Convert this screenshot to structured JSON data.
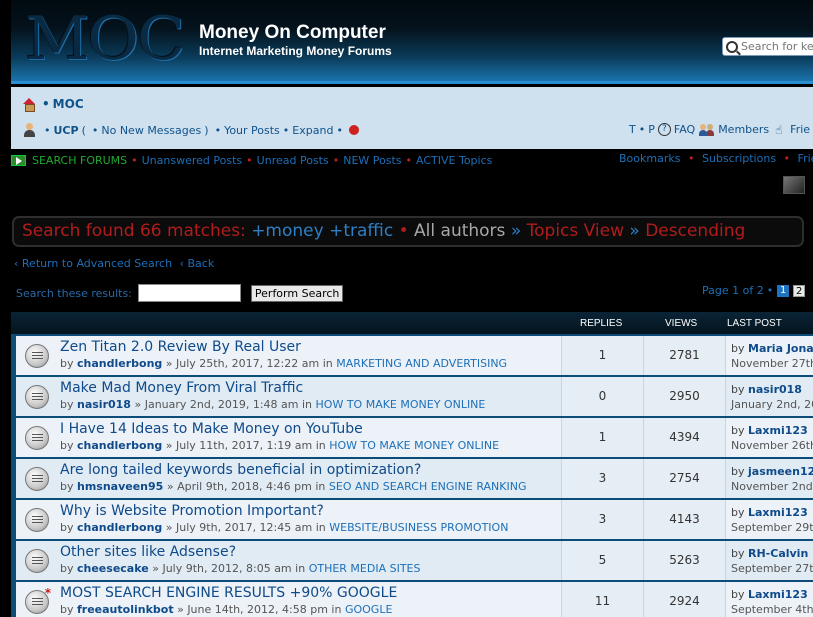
{
  "header": {
    "logo_text": "MOC",
    "site_title": "Money On Computer",
    "site_desc": "Internet Marketing Money Forums",
    "search_placeholder": "Search for ke"
  },
  "nav": {
    "home_label": "MOC",
    "ucp_label": "UCP",
    "new_messages": "No New Messages",
    "your_posts": "Your Posts",
    "expand": "Expand",
    "right_t": "T",
    "right_p": "P",
    "faq": "FAQ",
    "members": "Members",
    "friends": "Frie"
  },
  "quick": {
    "search_forums": "SEARCH FORUMS",
    "unanswered": "Unanswered Posts",
    "unread": "Unread Posts",
    "new_posts": "NEW Posts",
    "active": "ACTIVE Topics",
    "bookmarks": "Bookmarks",
    "subscriptions": "Subscriptions",
    "friends": "Frie"
  },
  "banner": {
    "prefix": "Search found 66 matches:",
    "terms": "+money +traffic",
    "authors": "All authors",
    "view": "Topics View",
    "order": "Descending"
  },
  "links": {
    "advanced": "Return to Advanced Search",
    "back": "Back"
  },
  "search_results": {
    "label": "Search these results:",
    "value": "",
    "button": "Perform Search"
  },
  "pagination": {
    "text": "Page 1 of 2",
    "current": "1",
    "next": "2"
  },
  "table_headers": {
    "replies": "REPLIES",
    "views": "VIEWS",
    "last_post": "LAST POST"
  },
  "topics": [
    {
      "title": "Zen Titan 2.0 Review By Real User",
      "author": "chandlerbong",
      "date": "July 25th, 2017, 12:22 am",
      "forum": "MARKETING AND ADVERTISING",
      "replies": "1",
      "views": "2781",
      "last_by": "Maria Jonas",
      "last_date": "November 27th"
    },
    {
      "title": "Make Mad Money From Viral Traffic",
      "author": "nasir018",
      "date": "January 2nd, 2019, 1:48 am",
      "forum": "HOW TO MAKE MONEY ONLINE",
      "replies": "0",
      "views": "2950",
      "last_by": "nasir018",
      "last_date": "January 2nd, 20"
    },
    {
      "title": "I Have 14 Ideas to Make Money on YouTube",
      "author": "chandlerbong",
      "date": "July 11th, 2017, 1:19 am",
      "forum": "HOW TO MAKE MONEY ONLINE",
      "replies": "1",
      "views": "4394",
      "last_by": "Laxmi123",
      "last_date": "November 26th"
    },
    {
      "title": "Are long tailed keywords beneficial in optimization?",
      "author": "hmsnaveen95",
      "date": "April 9th, 2018, 4:46 pm",
      "forum": "SEO AND SEARCH ENGINE RANKING",
      "replies": "3",
      "views": "2754",
      "last_by": "jasmeen12",
      "last_date": "November 2nd,"
    },
    {
      "title": "Why is Website Promotion Important?",
      "author": "chandlerbong",
      "date": "July 9th, 2017, 12:45 am",
      "forum": "WEBSITE/BUSINESS PROMOTION",
      "replies": "3",
      "views": "4143",
      "last_by": "Laxmi123",
      "last_date": "September 29th"
    },
    {
      "title": "Other sites like Adsense?",
      "author": "cheesecake",
      "date": "July 9th, 2012, 8:05 am",
      "forum": "OTHER MEDIA SITES",
      "replies": "5",
      "views": "5263",
      "last_by": "RH-Calvin",
      "last_date": "September 27th"
    },
    {
      "title": "MOST SEARCH ENGINE RESULTS +90% GOOGLE",
      "author": "freeautolinkbot",
      "date": "June 14th, 2012, 4:58 pm",
      "forum": "GOOGLE",
      "replies": "11",
      "views": "2924",
      "last_by": "Laxmi123",
      "last_date": "September 4th,"
    }
  ]
}
